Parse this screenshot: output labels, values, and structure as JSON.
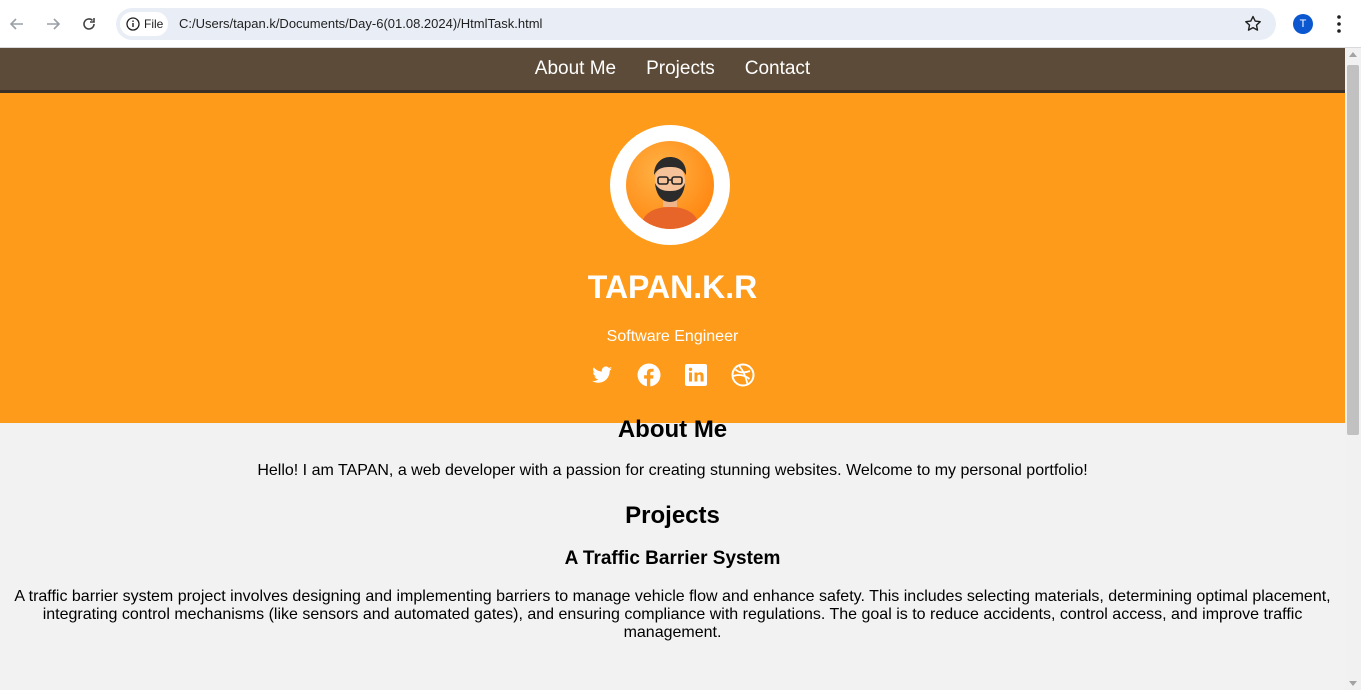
{
  "browser": {
    "chip_label": "File",
    "url": "C:/Users/tapan.k/Documents/Day-6(01.08.2024)/HtmlTask.html",
    "profile_initial": "T"
  },
  "nav": {
    "items": [
      {
        "label": "About Me"
      },
      {
        "label": "Projects"
      },
      {
        "label": "Contact"
      }
    ]
  },
  "hero": {
    "name": "TAPAN.K.R",
    "title": "Software Engineer",
    "socials": [
      "twitter-icon",
      "facebook-icon",
      "linkedin-icon",
      "dribbble-icon"
    ],
    "background": "#ff9b1a"
  },
  "about": {
    "heading": "About Me",
    "text": "Hello! I am TAPAN, a web developer with a passion for creating stunning websites. Welcome to my personal portfolio!"
  },
  "projects": {
    "heading": "Projects",
    "items": [
      {
        "title": "A Traffic Barrier System",
        "description": "A traffic barrier system project involves designing and implementing barriers to manage vehicle flow and enhance safety. This includes selecting materials, determining optimal placement, integrating control mechanisms (like sensors and automated gates), and ensuring compliance with regulations. The goal is to reduce accidents, control access, and improve traffic management."
      }
    ]
  },
  "colors": {
    "nav_bg": "#5c4b38",
    "accent": "#ff9b1a",
    "page_bg": "#f2f2f2"
  }
}
